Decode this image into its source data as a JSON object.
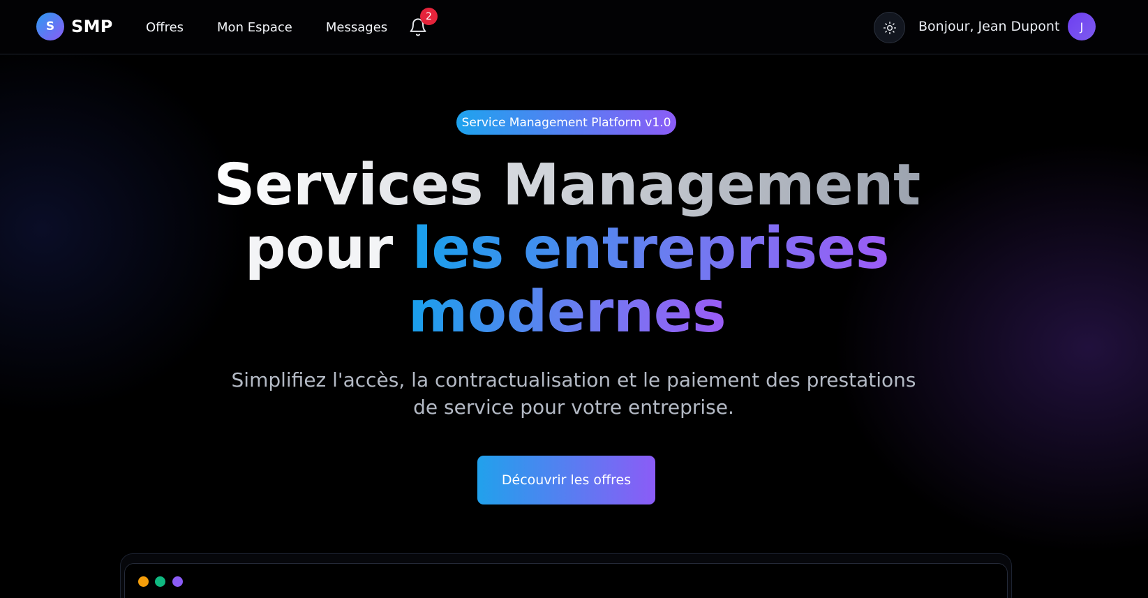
{
  "header": {
    "logo_letter": "S",
    "logo_text": "SMP",
    "nav": [
      {
        "label": "Offres"
      },
      {
        "label": "Mon Espace"
      },
      {
        "label": "Messages"
      }
    ],
    "notifications": {
      "count": "2",
      "icon": "bell-icon"
    },
    "theme_toggle": {
      "icon": "sun-icon"
    },
    "greeting": "Bonjour, Jean Dupont",
    "avatar_initial": "J"
  },
  "hero": {
    "badge": "Service Management Platform v1.0",
    "title_line1": "Services Management",
    "title_pour": "pour ",
    "title_highlight1": "les entreprises",
    "title_highlight2": "modernes",
    "subtitle": "Simplifiez l'accès, la contractualisation et le paiement des prestations de service pour votre entreprise.",
    "cta_label": "Découvrir les offres"
  },
  "preview": {
    "dots": [
      "#f59e0b",
      "#10b981",
      "#8b5cf6"
    ]
  },
  "colors": {
    "accent_blue": "#1ea3ee",
    "accent_purple": "#8b5cf6",
    "badge_red": "#e5243b",
    "background": "#000000"
  }
}
